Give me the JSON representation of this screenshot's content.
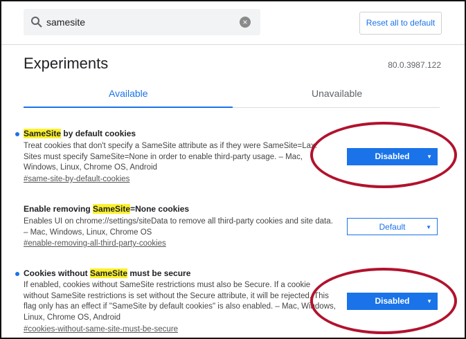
{
  "search": {
    "value": "samesite"
  },
  "reset_label": "Reset all to default",
  "page_title": "Experiments",
  "version": "80.0.3987.122",
  "tabs": [
    {
      "label": "Available",
      "active": true
    },
    {
      "label": "Unavailable",
      "active": false
    }
  ],
  "flags": [
    {
      "title_pre": "",
      "title_highlight": "SameSite",
      "title_post": " by default cookies",
      "description": "Treat cookies that don't specify a SameSite attribute as if they were SameSite=Lax. Sites must specify SameSite=None in order to enable third-party usage. – Mac, Windows, Linux, Chrome OS, Android",
      "link": "#same-site-by-default-cookies",
      "select_value": "Disabled",
      "modified": true
    },
    {
      "title_pre": "Enable removing ",
      "title_highlight": "SameSite",
      "title_post": "=None cookies",
      "description": "Enables UI on chrome://settings/siteData to remove all third-party cookies and site data. – Mac, Windows, Linux, Chrome OS",
      "link": "#enable-removing-all-third-party-cookies",
      "select_value": "Default",
      "modified": false
    },
    {
      "title_pre": "Cookies without ",
      "title_highlight": "SameSite",
      "title_post": " must be secure",
      "description": "If enabled, cookies without SameSite restrictions must also be Secure. If a cookie without SameSite restrictions is set without the Secure attribute, it will be rejected. This flag only has an effect if \"SameSite by default cookies\" is also enabled. – Mac, Windows, Linux, Chrome OS, Android",
      "link": "#cookies-without-same-site-must-be-secure",
      "select_value": "Disabled",
      "modified": true
    }
  ],
  "colors": {
    "accent": "#1a73e8",
    "highlight": "#fbf12b",
    "annotation": "#b1122d"
  }
}
